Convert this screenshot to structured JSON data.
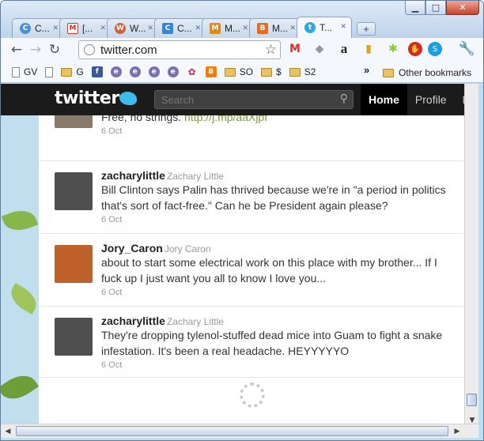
{
  "browser": {
    "tabs": [
      {
        "label": "C...",
        "icon": "chrome-favicon",
        "color": "#4a8fd8"
      },
      {
        "label": "[...",
        "icon": "gmail-favicon",
        "color": "#d93025"
      },
      {
        "label": "W...",
        "icon": "w-favicon",
        "color": "#d45e3a"
      },
      {
        "label": "C...",
        "icon": "c-favicon",
        "color": "#3a84d6"
      },
      {
        "label": "M...",
        "icon": "m-favicon",
        "color": "#e08a1e"
      },
      {
        "label": "M...",
        "icon": "blogger-favicon",
        "color": "#e86a24"
      },
      {
        "label": "T...",
        "icon": "twitter-favicon",
        "color": "#2fa8e0",
        "active": true
      }
    ],
    "url": "twitter.com",
    "bookmarks": [
      {
        "label": "GV",
        "type": "page"
      },
      {
        "label": "",
        "type": "page"
      },
      {
        "label": "G",
        "type": "folder"
      },
      {
        "label": "",
        "type": "facebook"
      },
      {
        "label": "",
        "type": "icon"
      },
      {
        "label": "",
        "type": "icon"
      },
      {
        "label": "",
        "type": "icon"
      },
      {
        "label": "",
        "type": "icon"
      },
      {
        "label": "",
        "type": "icon"
      },
      {
        "label": "",
        "type": "blogger"
      },
      {
        "label": "SO",
        "type": "folder"
      },
      {
        "label": "$",
        "type": "folder"
      },
      {
        "label": "S2",
        "type": "folder"
      }
    ],
    "other_bookmarks": "Other bookmarks"
  },
  "twitter": {
    "logo": "twitter",
    "search_placeholder": "Search",
    "nav": [
      "Home",
      "Profile",
      "M"
    ],
    "tweets": [
      {
        "user": "",
        "name": "",
        "text_main": "Free, no strings. ",
        "link": "http://j.mp/aaXjpf",
        "date": "6 Oct",
        "avatar_color": "#8a7a6a"
      },
      {
        "user": "zacharylittle",
        "name": "Zachary Little",
        "text_main": "Bill Clinton says Palin has thrived because we're in \"a period in politics that's sort of fact-free.\" Can he be President again please?",
        "link": "",
        "date": "6 Oct",
        "avatar_color": "#5b5b5b"
      },
      {
        "user": "Jory_Caron",
        "name": "Jory Caron",
        "text_main": "about to start some electrical work on this place with my brother... If I fuck up I just want you all to know I love you...",
        "link": "",
        "date": "6 Oct",
        "avatar_color": "#c0602a"
      },
      {
        "user": "zacharylittle",
        "name": "Zachary Little",
        "text_main": "They're dropping tylenol-stuffed dead mice into Guam to fight a snake infestation. It's been a real headache. HEYYYYYO",
        "link": "",
        "date": "6 Oct",
        "avatar_color": "#5b5b5b"
      }
    ]
  }
}
